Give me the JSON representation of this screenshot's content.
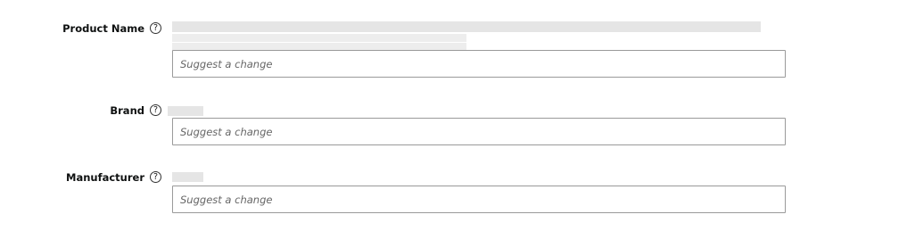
{
  "fields": [
    {
      "label": "Product Name",
      "help_icon": "question-circle-icon",
      "current_value": "",
      "input_value": "",
      "placeholder": "Suggest a change"
    },
    {
      "label": "Brand",
      "help_icon": "question-circle-icon",
      "current_value": "",
      "input_value": "",
      "placeholder": "Suggest a change"
    },
    {
      "label": "Manufacturer",
      "help_icon": "question-circle-icon",
      "current_value": "",
      "input_value": "",
      "placeholder": "Suggest a change"
    }
  ]
}
